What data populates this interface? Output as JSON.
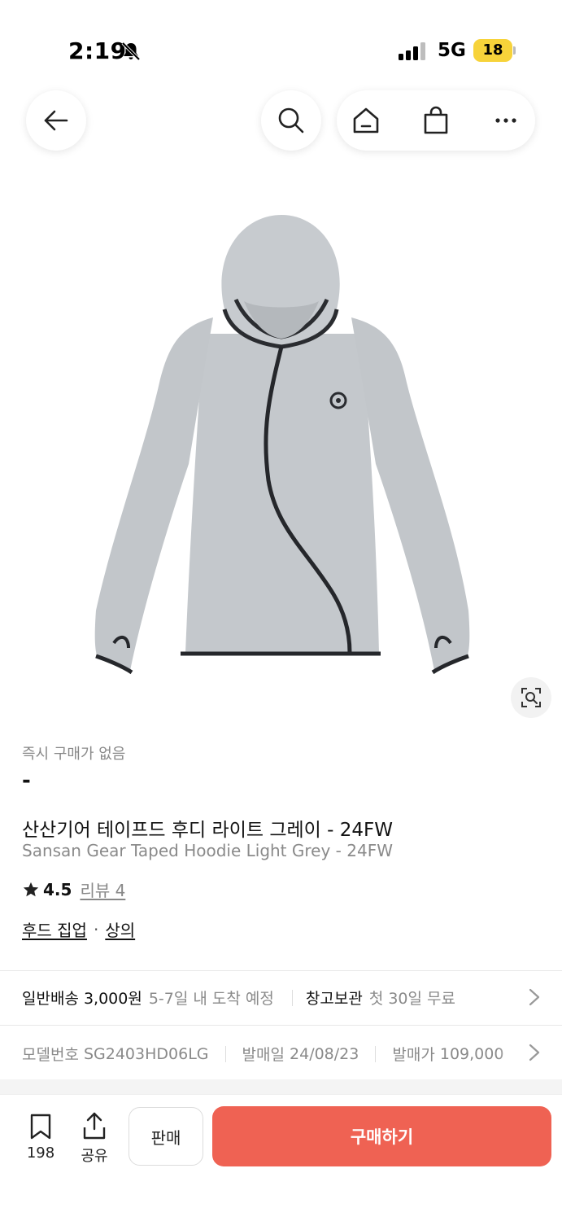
{
  "status_bar": {
    "time": "2:19",
    "network": "5G",
    "battery_level": "18"
  },
  "nav": {
    "back_icon": "arrow-left-icon",
    "search_icon": "search-icon",
    "home_icon": "home-icon",
    "cart_icon": "shopping-bag-icon",
    "more_icon": "more-dots-icon"
  },
  "product": {
    "image_alt": "grey hoodie with black asymmetric zipper trim",
    "lens_icon": "image-search-icon",
    "instant_buy_note": "즉시 구매가 없음",
    "price": "-",
    "title_ko": "산산기어 테이프드 후디 라이트 그레이 - 24FW",
    "title_en": "Sansan Gear Taped Hoodie Light Grey - 24FW",
    "rating": "4.5",
    "review_label": "리뷰 4",
    "category_1": "후드 집업",
    "category_sep": "·",
    "category_2": "상의"
  },
  "shipping": {
    "standard_label": "일반배송 3,000원",
    "standard_eta": "5-7일 내 도착 예정",
    "storage_label": "창고보관",
    "storage_note": "첫 30일 무료"
  },
  "specs": {
    "model_label": "모델번호",
    "model_value": "SG2403HD06LG",
    "release_label": "발매일",
    "release_value": "24/08/23",
    "retail_label": "발매가",
    "retail_value": "109,000"
  },
  "bottom_bar": {
    "bookmark_count": "198",
    "share_label": "공유",
    "sell_label": "판매",
    "buy_label": "구매하기"
  },
  "colors": {
    "accent": "#ef6253",
    "battery": "#f7d33a"
  }
}
